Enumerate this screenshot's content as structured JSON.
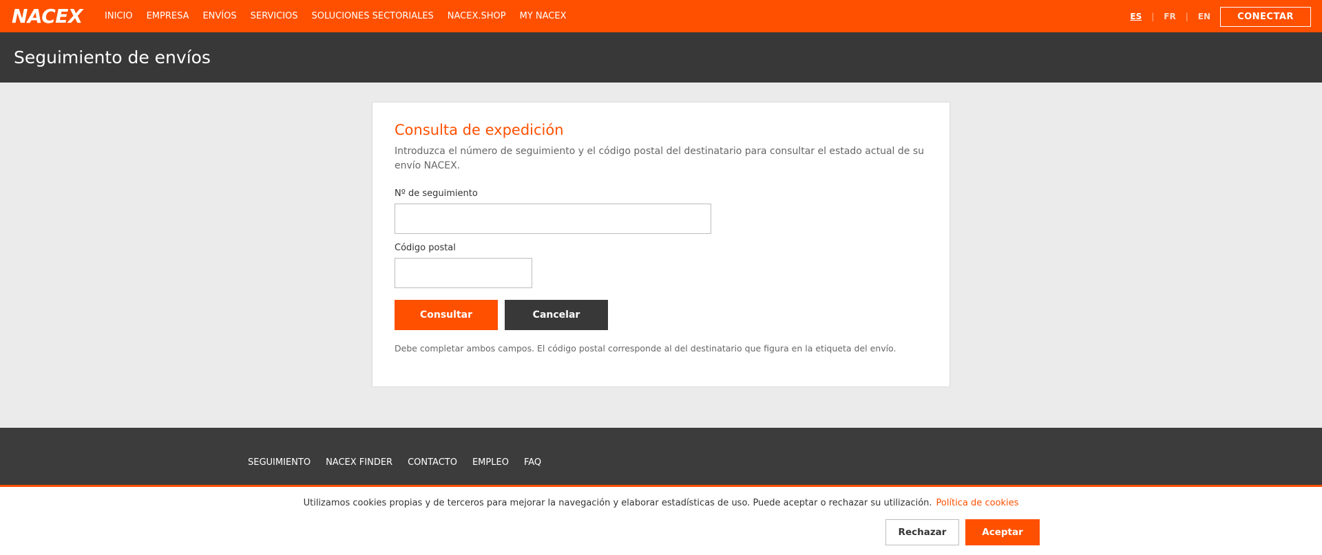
{
  "header": {
    "logo": "NACEX",
    "nav": [
      "INICIO",
      "EMPRESA",
      "ENVÍOS",
      "SERVICIOS",
      "SOLUCIONES SECTORIALES",
      "NACEX.SHOP",
      "MY NACEX"
    ],
    "languages": [
      "ES",
      "FR",
      "EN"
    ],
    "active_language": "ES",
    "connect_label": "CONECTAR"
  },
  "page": {
    "title": "Seguimiento de envíos"
  },
  "form": {
    "heading": "Consulta de expedición",
    "intro": "Introduzca el número de seguimiento y el código postal del destinatario para consultar el estado actual de su envío NACEX.",
    "tracking_label": "Nº de seguimiento",
    "tracking_value": "",
    "postal_label": "Código postal",
    "postal_value": "",
    "submit_label": "Consultar",
    "cancel_label": "Cancelar",
    "note": "Debe completar ambos campos. El código postal corresponde al del destinatario que figura en la etiqueta del envío."
  },
  "footer": {
    "links": [
      "SEGUIMIENTO",
      "NACEX FINDER",
      "CONTACTO",
      "EMPLEO",
      "FAQ"
    ]
  },
  "cookies": {
    "text": "Utilizamos cookies propias y de terceros para mejorar la navegación y elaborar estadísticas de uso. Puede aceptar o rechazar su utilización.",
    "policy_link": "Política de cookies",
    "reject_label": "Rechazar",
    "accept_label": "Aceptar"
  },
  "colors": {
    "brand": "#ff5000",
    "dark": "#383838",
    "background": "#ebebeb"
  }
}
